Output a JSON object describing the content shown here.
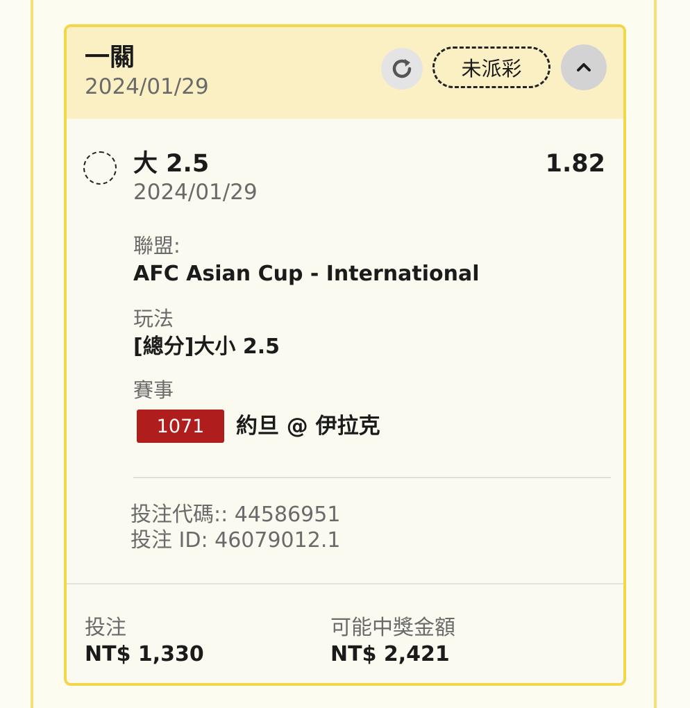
{
  "card": {
    "bet_type": "一關",
    "date": "2024/01/29",
    "status": "未派彩",
    "refresh_icon": "refresh-icon",
    "collapse_icon": "chevron-up-icon"
  },
  "selection": {
    "label": "大 2.5",
    "date": "2024/01/29",
    "odds": "1.82"
  },
  "details": {
    "league_label": "聯盟:",
    "league_value": "AFC Asian Cup - International",
    "market_label": "玩法",
    "market_value": "[總分]大小 2.5",
    "event_label": "賽事",
    "event_id": "1071",
    "event_name": "約旦 @ 伊拉克"
  },
  "codes": {
    "bet_code": "投注代碼:: 44586951",
    "bet_id": "投注 ID: 46079012.1"
  },
  "footer": {
    "stake_label": "投注",
    "stake_value": "NT$ 1,330",
    "payout_label": "可能中獎金額",
    "payout_value": "NT$ 2,421"
  },
  "colors": {
    "accent_border": "#f4d64a",
    "header_bg": "#fbf0c4",
    "match_badge": "#b01d1d"
  }
}
